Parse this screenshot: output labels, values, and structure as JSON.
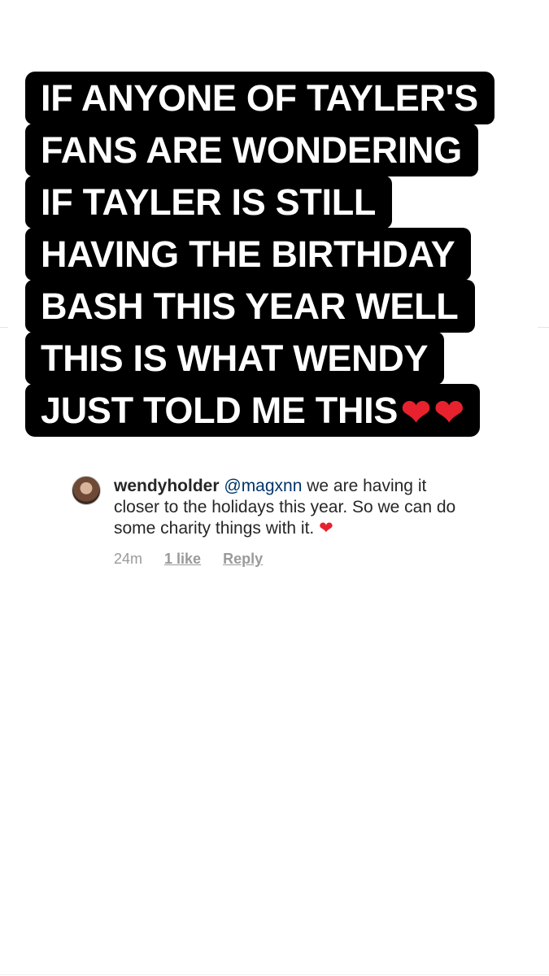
{
  "caption": {
    "lines": [
      "IF ANYONE OF TAYLER'S",
      "FANS ARE WONDERING",
      "IF TAYLER IS STILL",
      "HAVING THE BIRTHDAY",
      "BASH THIS YEAR WELL",
      "THIS IS WHAT WENDY",
      "JUST TOLD ME THIS"
    ],
    "trailing_hearts": [
      "❤",
      "❤"
    ]
  },
  "comment": {
    "username": "wendyholder",
    "mention": "@magxnn",
    "text": " we are having it closer to the holidays this year.  So we can do some charity things with it. ",
    "heart": "❤",
    "timestamp": "24m",
    "likes": "1 like",
    "reply": "Reply"
  },
  "colors": {
    "background": "#ffffff",
    "caption_bg": "#000000",
    "caption_text": "#ffffff",
    "heart": "#e8212e",
    "mention": "#003569",
    "meta": "#9a9a9a"
  }
}
